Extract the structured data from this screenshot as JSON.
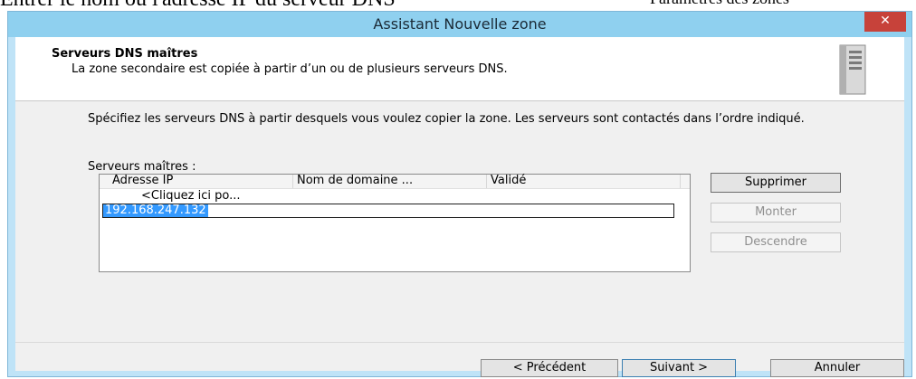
{
  "document": {
    "overlay_text": "Entrer le nom ou l'adresse IP du serveur DNS",
    "overlay_text_right": "Paramètres des zones"
  },
  "window": {
    "title": "Assistant Nouvelle zone",
    "close_icon": "close-icon"
  },
  "header": {
    "title": "Serveurs DNS maîtres",
    "subtitle": "La zone secondaire est copiée à partir d’un ou de plusieurs serveurs DNS.",
    "icon": "server-icon"
  },
  "body": {
    "description": "Spécifiez les serveurs DNS à partir desquels vous voulez copier la zone. Les serveurs sont contactés dans l’ordre indiqué.",
    "list_label": "Serveurs maîtres :"
  },
  "listview": {
    "columns": [
      "Adresse IP",
      "Nom de domaine ...",
      "Validé"
    ],
    "placeholder_row": "<Cliquez ici po...",
    "edit_value": "192.168.247.132"
  },
  "side_buttons": {
    "delete": "Supprimer",
    "up": "Monter",
    "down": "Descendre"
  },
  "footer": {
    "prev": "< Précédent",
    "next": "Suivant >",
    "cancel": "Annuler"
  }
}
